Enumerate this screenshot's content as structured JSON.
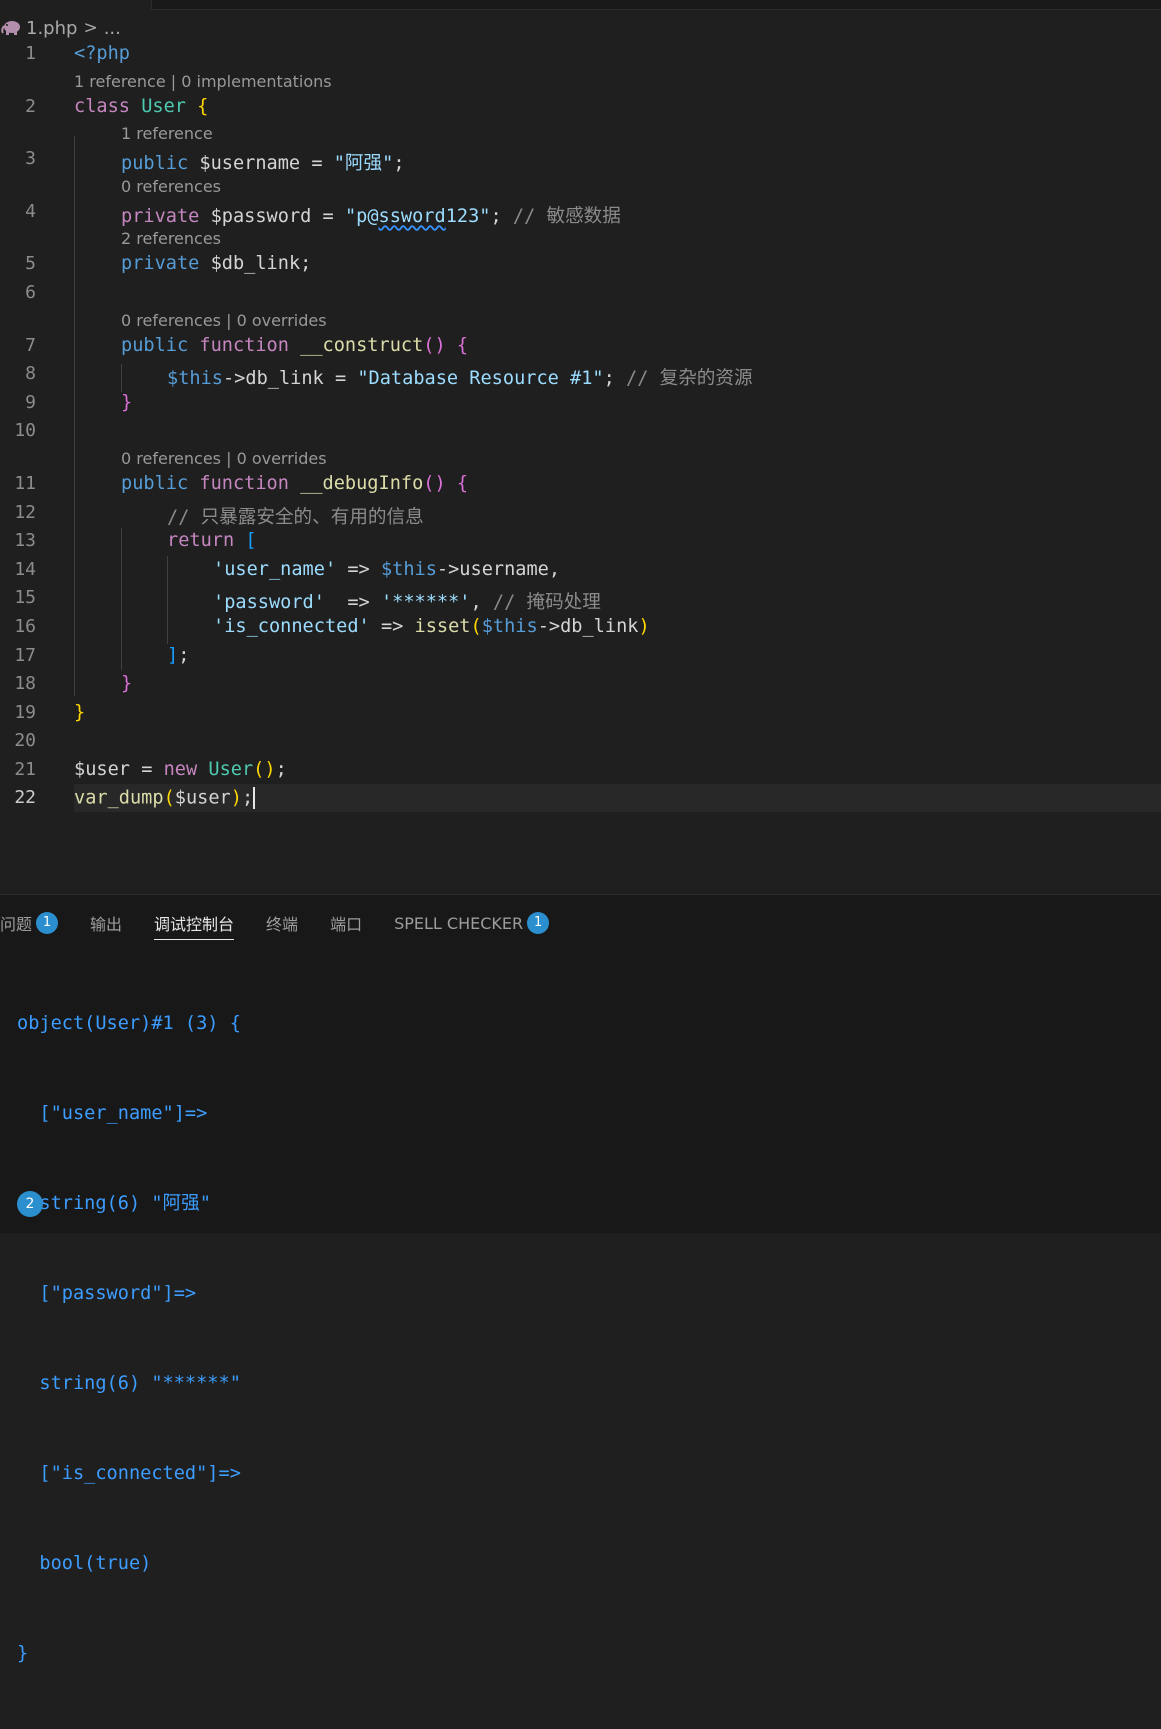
{
  "breadcrumb": {
    "file": "1.php",
    "separator": ">",
    "ellipsis": "..."
  },
  "code_lines": [
    {
      "num": "1",
      "text": "<?php"
    },
    {
      "num": "2",
      "text": "class User {"
    },
    {
      "num": "3",
      "text": "public $username = \"阿强\";"
    },
    {
      "num": "4",
      "text": "private $password = \"p@ssword123\"; // 敏感数据"
    },
    {
      "num": "5",
      "text": "private $db_link;"
    },
    {
      "num": "6",
      "text": ""
    },
    {
      "num": "7",
      "text": "public function __construct() {"
    },
    {
      "num": "8",
      "text": "$this->db_link = \"Database Resource #1\"; // 复杂的资源"
    },
    {
      "num": "9",
      "text": "}"
    },
    {
      "num": "10",
      "text": ""
    },
    {
      "num": "11",
      "text": "public function __debugInfo() {"
    },
    {
      "num": "12",
      "text": "// 只暴露安全的、有用的信息"
    },
    {
      "num": "13",
      "text": "return ["
    },
    {
      "num": "14",
      "text": "'user_name' => $this->username,"
    },
    {
      "num": "15",
      "text": "'password'  => '******', // 掩码处理"
    },
    {
      "num": "16",
      "text": "'is_connected' => isset($this->db_link)"
    },
    {
      "num": "17",
      "text": "];"
    },
    {
      "num": "18",
      "text": "}"
    },
    {
      "num": "19",
      "text": "}"
    },
    {
      "num": "20",
      "text": ""
    },
    {
      "num": "21",
      "text": "$user = new User();"
    },
    {
      "num": "22",
      "text": "var_dump($user);"
    }
  ],
  "codelens": {
    "class_user": "1 reference | 0 implementations",
    "username": "1 reference",
    "password": "0 references",
    "db_link": "2 references",
    "construct": "0 references | 0 overrides",
    "debuginfo": "0 references | 0 overrides"
  },
  "panel": {
    "tabs": [
      {
        "label": "问题",
        "badge": "1"
      },
      {
        "label": "输出"
      },
      {
        "label": "调试控制台",
        "active": true
      },
      {
        "label": "终端"
      },
      {
        "label": "端口"
      },
      {
        "label": "SPELL CHECKER",
        "badge": "1"
      }
    ],
    "console_lines": [
      "object(User)#1 (3) {",
      "  [\"user_name\"]=>",
      "  string(6) \"阿强\"",
      "  [\"password\"]=>",
      "  string(6) \"******\"",
      "  [\"is_connected\"]=>",
      "  bool(true)",
      "}"
    ],
    "console_badge": "2"
  },
  "colors": {
    "background": "#1f1f1f",
    "keyword": "#569cd6",
    "control": "#c586c0",
    "class": "#4ec9b0",
    "function": "#dcdcaa",
    "string": "#ce9178",
    "comment": "#8b8b8b",
    "console_text": "#3c9dff",
    "badge": "#2b8fcf"
  }
}
